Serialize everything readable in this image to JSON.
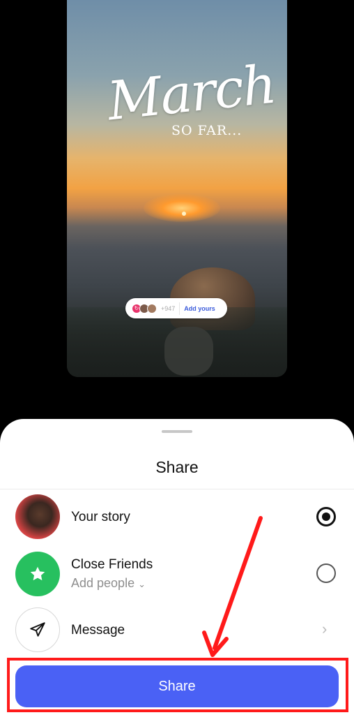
{
  "story": {
    "title": "March",
    "subtitle": "SO FAR...",
    "sticker": {
      "count": "+947",
      "label": "Add yours"
    }
  },
  "sheet": {
    "title": "Share",
    "options": [
      {
        "label": "Your story",
        "selected": true
      },
      {
        "label": "Close Friends",
        "sublabel": "Add people",
        "selected": false
      },
      {
        "label": "Message"
      }
    ],
    "share_button": "Share"
  },
  "colors": {
    "accent": "#4a61f5",
    "highlight": "#ff1a1a",
    "close_friends": "#27c05f"
  }
}
